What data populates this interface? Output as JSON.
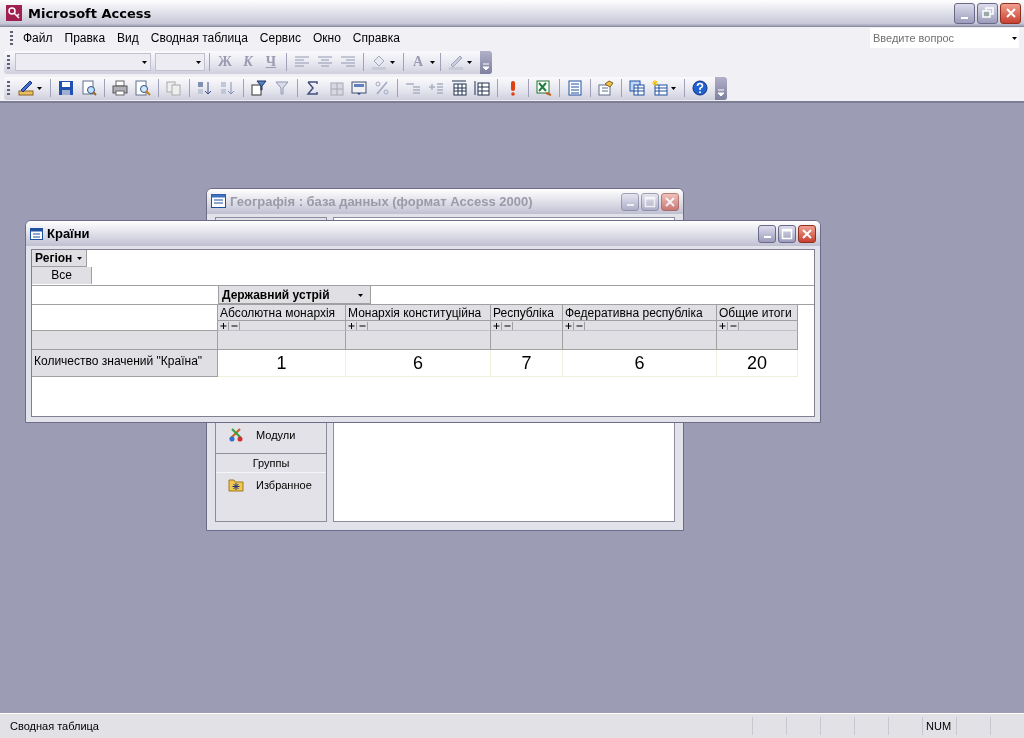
{
  "window": {
    "title": "Microsoft Access"
  },
  "menu": [
    {
      "label": "Файл"
    },
    {
      "label": "Правка"
    },
    {
      "label": "Вид"
    },
    {
      "label": "Сводная таблица"
    },
    {
      "label": "Сервис"
    },
    {
      "label": "Окно"
    },
    {
      "label": "Справка"
    }
  ],
  "help_search": {
    "placeholder": "Введите вопрос"
  },
  "formatting_toolbar": {
    "text_buttons": [
      {
        "label": "Ж",
        "disabled": true
      },
      {
        "label": "К",
        "disabled": true
      },
      {
        "label": "Ч",
        "disabled": true
      }
    ],
    "font_color_button": {
      "label": "A",
      "disabled": true
    }
  },
  "database_window": {
    "title": "Географія : база данных (формат Access 2000)",
    "active": false,
    "objects": [
      {
        "label": "Модули"
      }
    ],
    "groups_header": "Группы",
    "groups": [
      {
        "label": "Избранное"
      }
    ]
  },
  "pivot_window": {
    "title": "Країни",
    "active": true,
    "filter_field": {
      "label": "Регіон",
      "value": "Все"
    },
    "column_field": {
      "label": "Державний устрій"
    },
    "row_label": "Количество значений \"Країна\"",
    "columns": [
      {
        "label": "Абсолютна монархія",
        "value": "1"
      },
      {
        "label": "Монархія конституційна",
        "value": "6"
      },
      {
        "label": "Республіка",
        "value": "7"
      },
      {
        "label": "Федеративна республіка",
        "value": "6"
      },
      {
        "label": "Общие итоги",
        "value": "20"
      }
    ]
  },
  "status_bar": {
    "text": "Сводная таблица",
    "indicators": [
      "NUM"
    ]
  }
}
